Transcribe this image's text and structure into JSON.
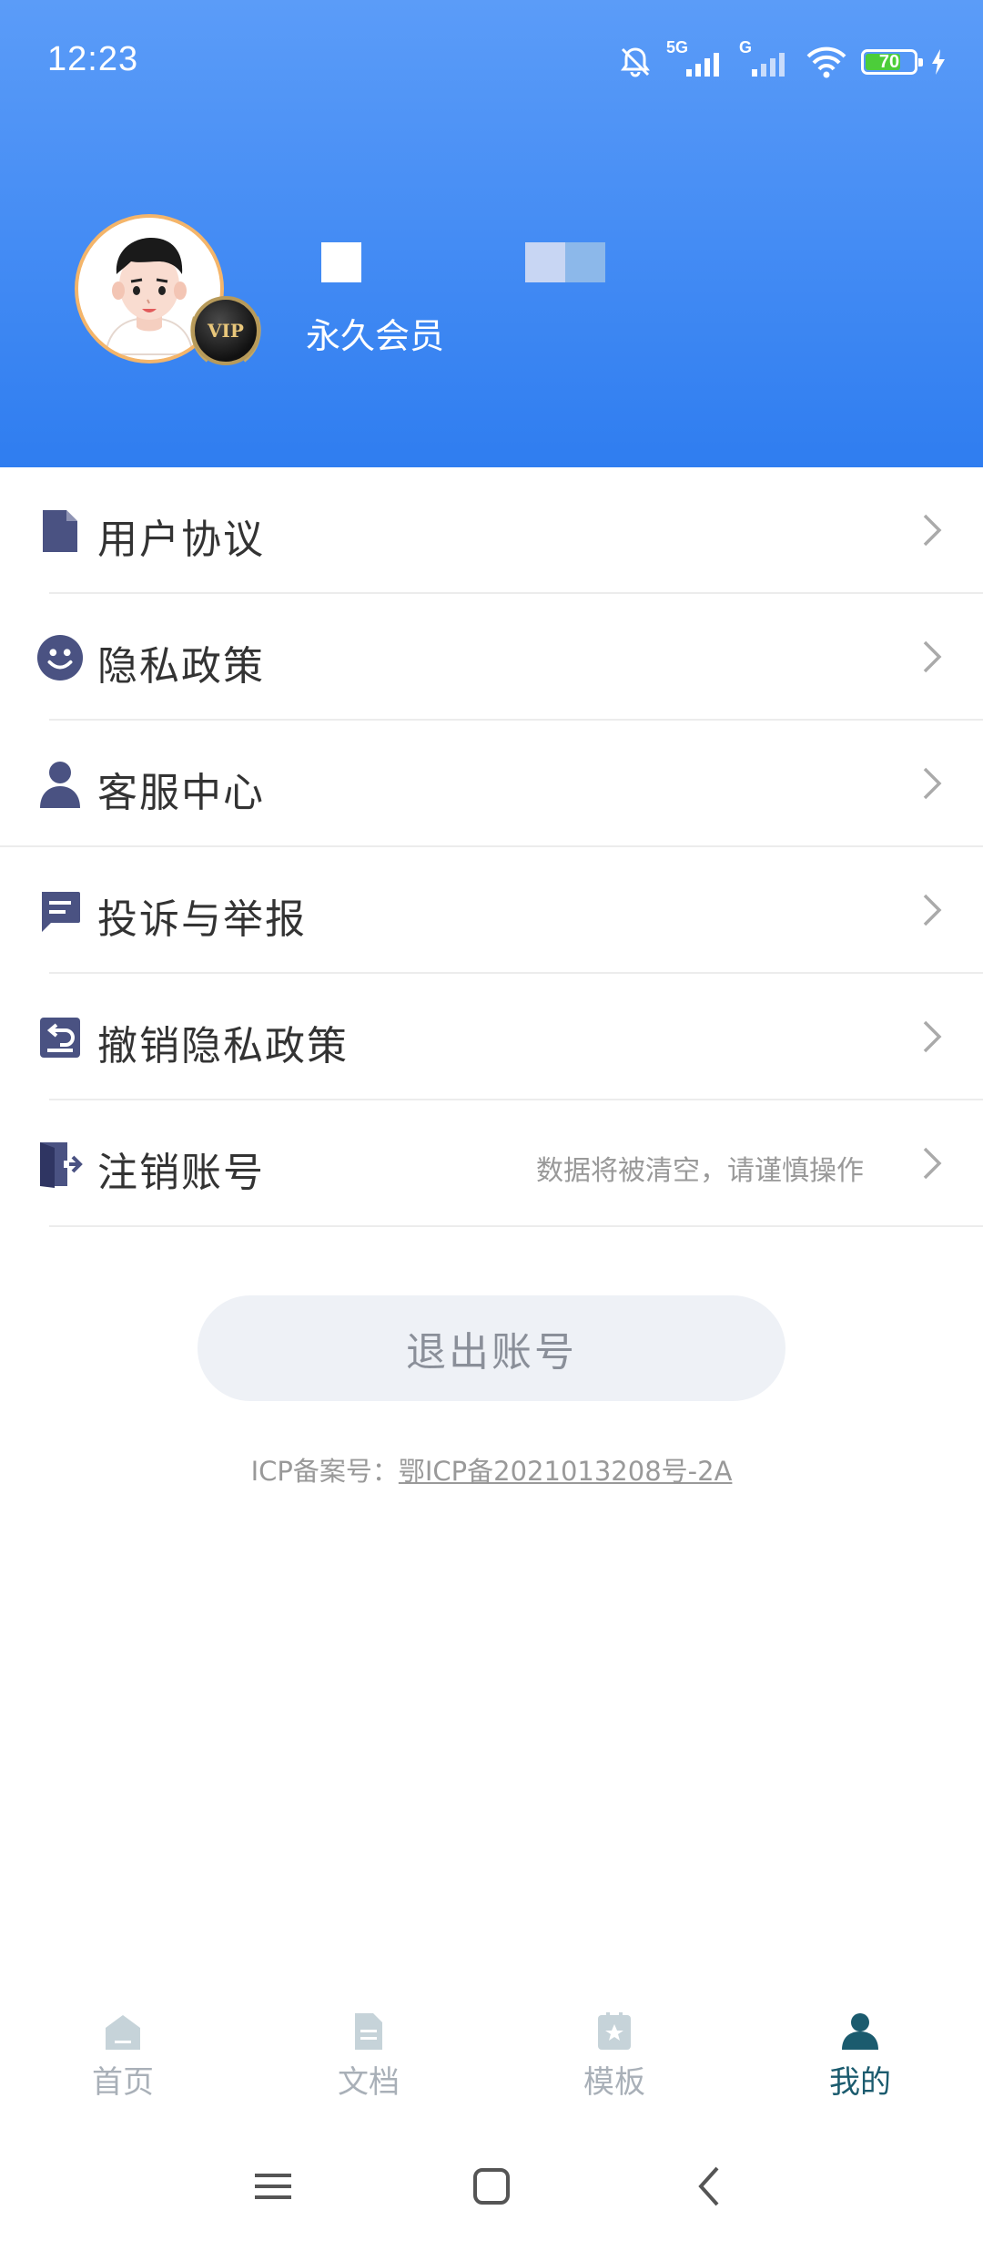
{
  "status_bar": {
    "time": "12:23",
    "network_1": "5G",
    "network_2": "G",
    "battery": "70"
  },
  "profile": {
    "membership": "永久会员",
    "vip_text": "VIP"
  },
  "menu": [
    {
      "label": "用户协议",
      "icon": "document-icon"
    },
    {
      "label": "隐私政策",
      "icon": "smiley-icon"
    },
    {
      "label": "客服中心",
      "icon": "person-icon"
    },
    {
      "label": "投诉与举报",
      "icon": "message-icon"
    },
    {
      "label": "撤销隐私政策",
      "icon": "revoke-icon"
    },
    {
      "label": "注销账号",
      "icon": "exit-icon",
      "hint": "数据将被清空，请谨慎操作"
    }
  ],
  "logout_label": "退出账号",
  "icp": {
    "prefix": "ICP备案号：",
    "number": "鄂ICP备2021013208号-2A"
  },
  "tabs": [
    {
      "label": "首页",
      "icon": "home-icon",
      "active": false
    },
    {
      "label": "文档",
      "icon": "doc-icon",
      "active": false
    },
    {
      "label": "模板",
      "icon": "template-icon",
      "active": false
    },
    {
      "label": "我的",
      "icon": "user-icon",
      "active": true
    }
  ],
  "colors": {
    "header_top": "#5b9cf8",
    "header_bottom": "#2f7df0",
    "menu_icon": "#4a5282",
    "tab_active": "#1b5b6e",
    "tab_inactive": "#a9b0b8"
  }
}
